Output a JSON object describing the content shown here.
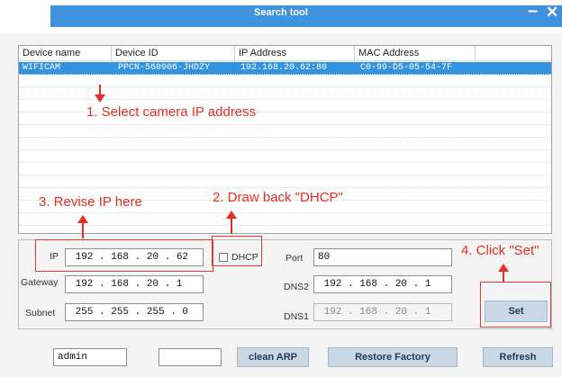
{
  "window": {
    "title": "Search tool",
    "minimize_glyph": "–",
    "close_glyph": "✕"
  },
  "table": {
    "headers": [
      "Device name",
      "Device ID",
      "IP Address",
      "MAC Address"
    ],
    "rows": [
      {
        "name": "WIFICAM",
        "id": "PPCN-560906-JHDZY",
        "ip": "192.168.20.62:80",
        "mac": "C0-99-D5-05-54-7F",
        "selected": true
      }
    ]
  },
  "form": {
    "ip_label": "IP",
    "ip_value": " 192 . 168 . 20 . 62",
    "gateway_label": "Gateway",
    "gateway_value": " 192 . 168 . 20 . 1",
    "subnet_label": "Subnet",
    "subnet_value": " 255 . 255 . 255 . 0",
    "dhcp_label": "DHCP",
    "dhcp_checked": false,
    "port_label": "Port",
    "port_value": "80",
    "dns2_label": "DNS2",
    "dns2_value": " 192 . 168 . 20 . 1",
    "dns1_label": "DNS1",
    "dns1_value": " 192 . 168 . 20 . 1",
    "set_label": "Set"
  },
  "bottom": {
    "user_value": "admin",
    "password_value": "",
    "clean_arp_label": "clean ARP",
    "restore_label": "Restore Factory",
    "refresh_label": "Refresh"
  },
  "annotations": {
    "step1": "1. Select camera IP address",
    "step2": "2. Draw back \"DHCP\"",
    "step3": "3. Revise IP here",
    "step4": "4. Click \"Set\""
  },
  "colors": {
    "title_band": "#3f92dd",
    "selection": "#3393df",
    "annotation": "#ea2d22",
    "button": "#cad7e5"
  }
}
